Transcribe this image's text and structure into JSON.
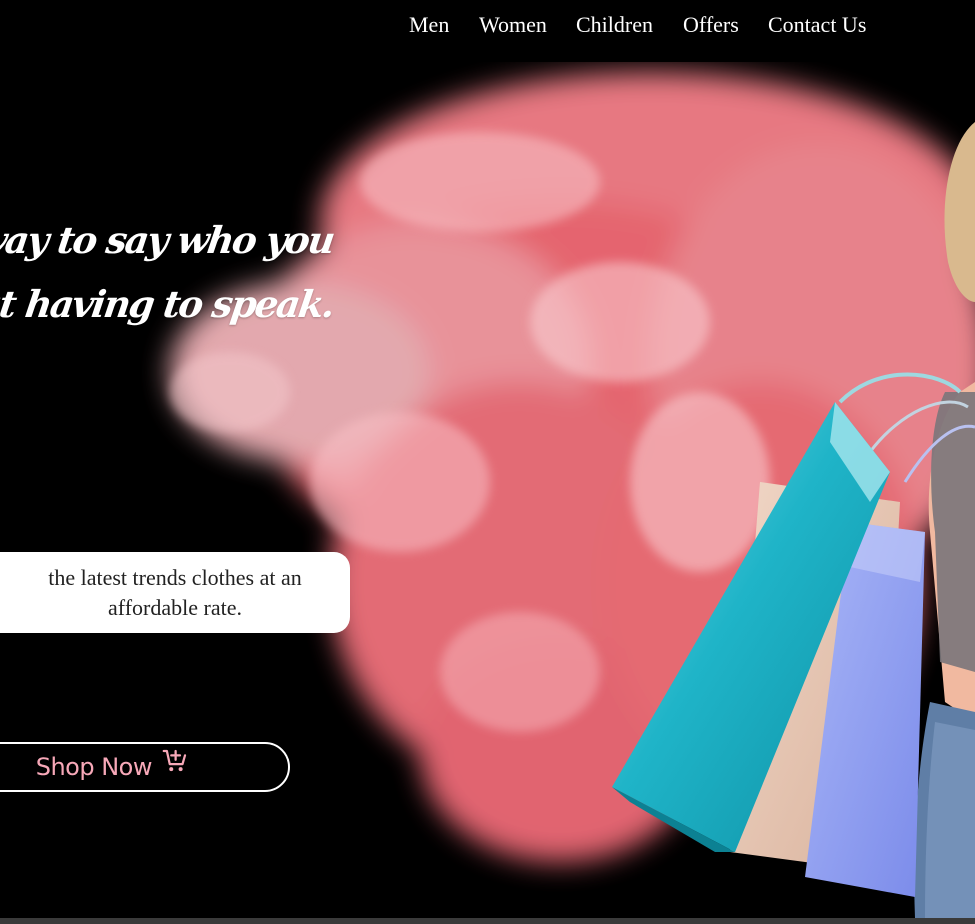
{
  "nav": {
    "items": [
      {
        "label": "Men"
      },
      {
        "label": "Women"
      },
      {
        "label": "Children"
      },
      {
        "label": "Offers"
      },
      {
        "label": "Contact Us"
      }
    ]
  },
  "hero": {
    "tagline_line1": "r a way to say who you",
    "tagline_line2": "ithout having to speak.",
    "description": "the latest trends clothes at an affordable rate.",
    "cta_label": "Shop Now",
    "cta_icon": "cart-plus-icon"
  },
  "colors": {
    "background": "#000000",
    "accent_pink": "#f7a8b8",
    "smoke_coral": "#f26a74",
    "bag_teal": "#1fb4c8",
    "bag_lavender": "#8f9ff2",
    "bag_tan": "#e6c3b0"
  }
}
